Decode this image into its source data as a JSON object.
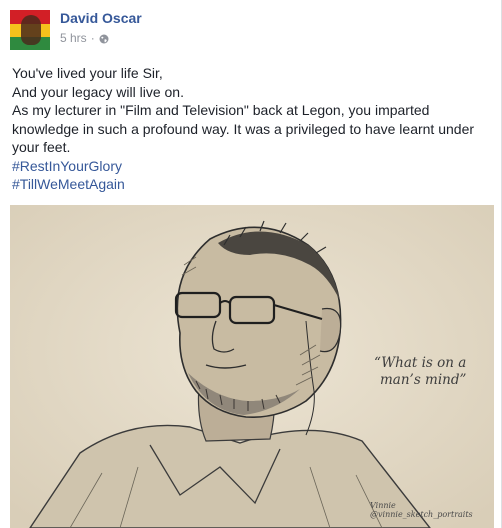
{
  "post": {
    "author": "David Oscar",
    "time": "5 hrs",
    "privacy_icon": "globe-icon",
    "lines": [
      "You've lived your life Sir,",
      "And your legacy will live on.",
      "As my lecturer in \"Film and Television\" back at Legon, you imparted knowledge in such a profound way. It was a privileged to have learnt under your feet."
    ],
    "hashtags": [
      "#RestInYourGlory",
      "#TillWeMeetAgain"
    ]
  },
  "image": {
    "quote_line1": "“What is on a",
    "quote_line2": "man’s mind”",
    "signature": "Vinnie",
    "signature_handle": "@vinnie_sketch_portraits"
  },
  "colors": {
    "link": "#365899",
    "meta": "#90949c",
    "text": "#1d2129",
    "paper": "#e4dbc8",
    "flag_red": "#d21f26",
    "flag_yellow": "#f6c21d",
    "flag_green": "#2f8a3f"
  }
}
